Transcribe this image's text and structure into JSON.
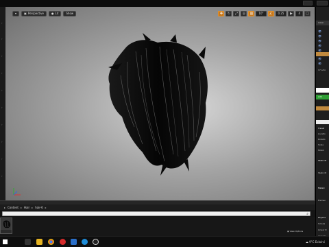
{
  "viewport": {
    "perspective_label": "Perspective",
    "lit_label": "Lit",
    "show_label": "Show",
    "grid_snap_value": "10°",
    "scale_snap_value": "0.25",
    "camera_speed_value": "4"
  },
  "content_browser": {
    "breadcrumb": [
      "Content",
      "Hair",
      "hair-6"
    ],
    "view_options_label": "View Options"
  },
  "right_panel": {
    "label_partial": "Label",
    "count_partial": "17 acto",
    "add_partial": "Add",
    "section_transform": "Transf",
    "loc_label": "Locatio",
    "rot_label": "Rotatio",
    "scale_label": "Scale",
    "mob_label": "Mobili",
    "static_section": "Static M",
    "static_mesh": "Static M",
    "material_section": "Materi",
    "element": "Elemen",
    "physics_section": "Physics",
    "simulate": "Simula",
    "linear": "Linear D",
    "angular": "Angular"
  },
  "taskbar": {
    "temperature": "9°C",
    "weather": "Eclairci"
  },
  "colors": {
    "accent": "#c6781e",
    "add_button": "#2f9e35",
    "selection": "#c18a3e"
  }
}
